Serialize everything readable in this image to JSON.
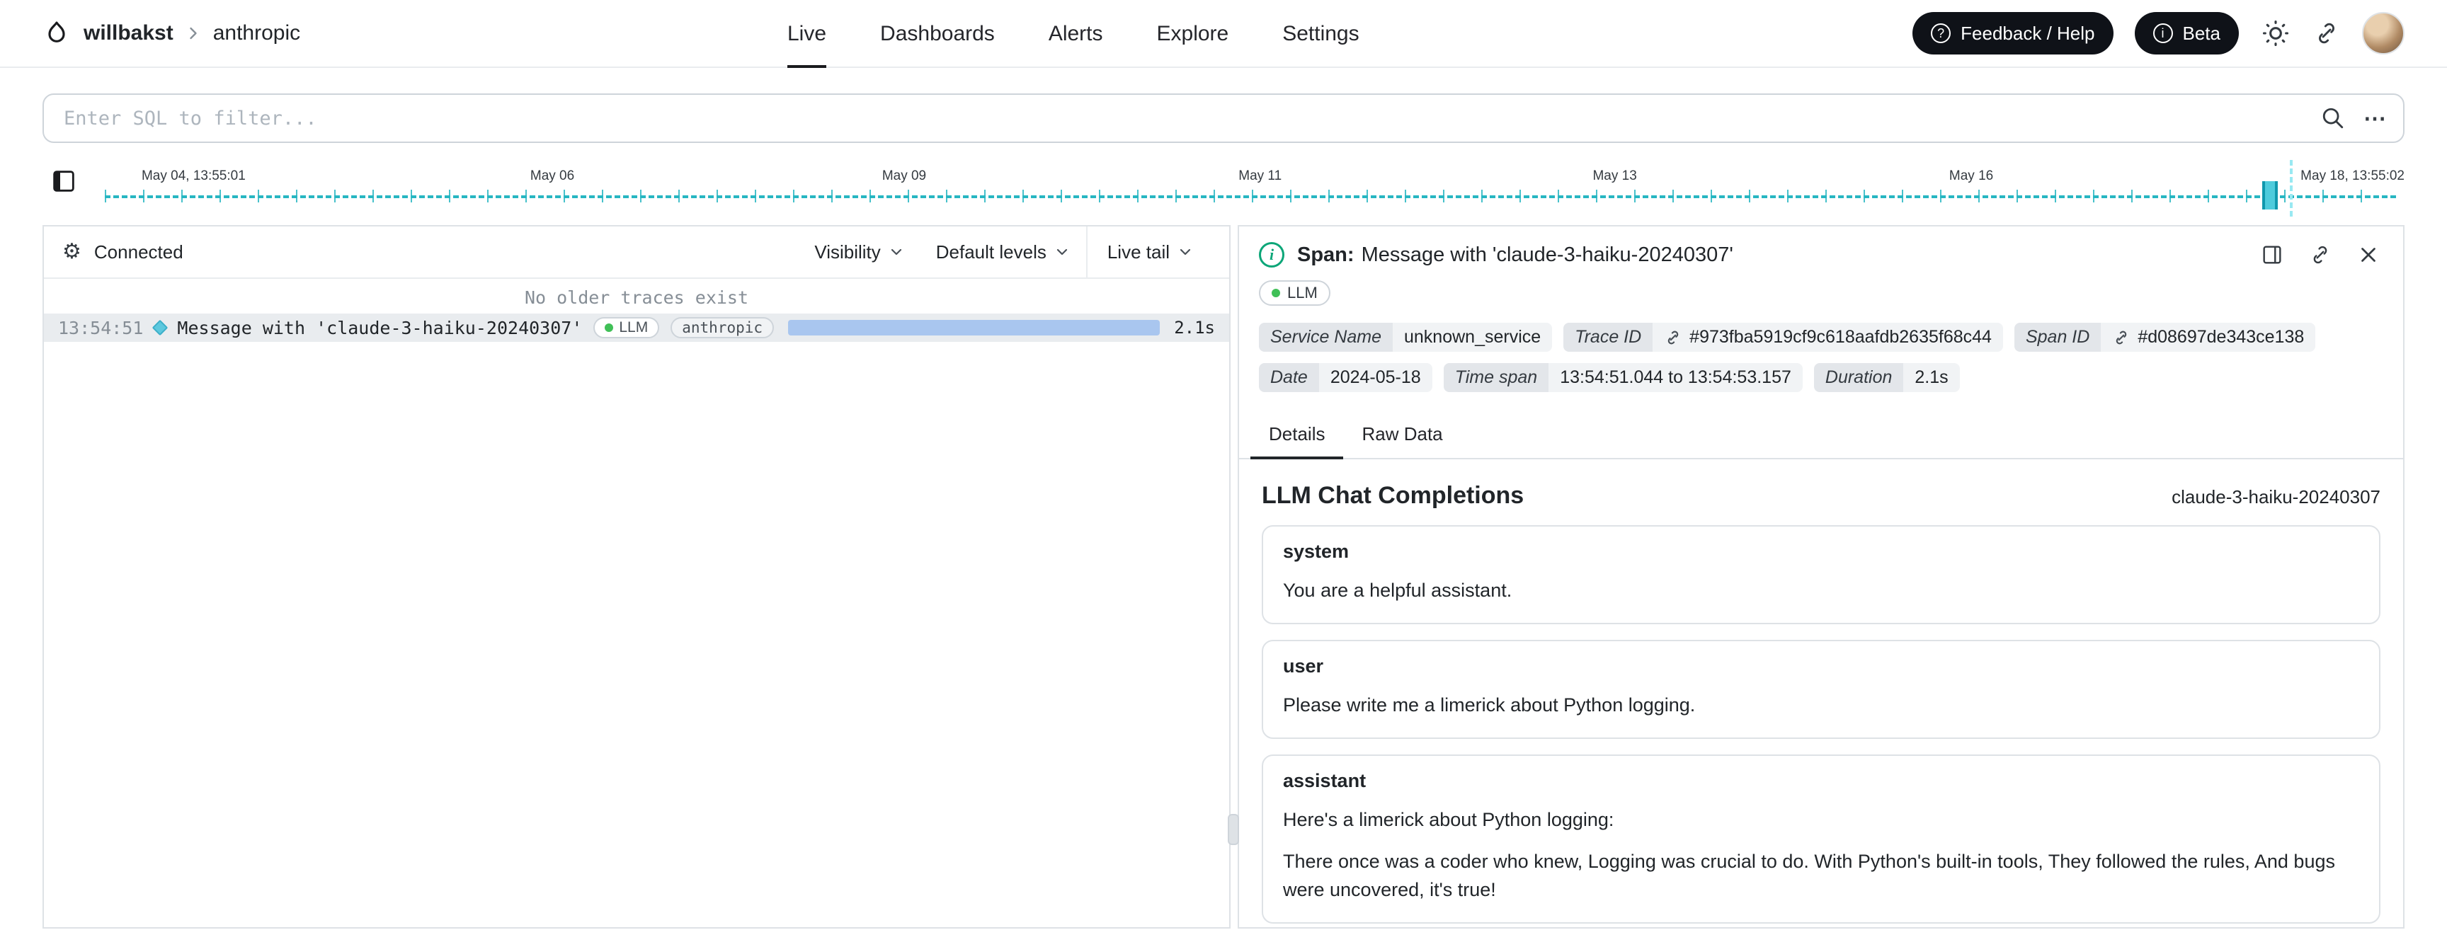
{
  "nav": {
    "org": "willbakst",
    "project": "anthropic",
    "items": [
      {
        "label": "Live",
        "active": true
      },
      {
        "label": "Dashboards",
        "active": false
      },
      {
        "label": "Alerts",
        "active": false
      },
      {
        "label": "Explore",
        "active": false
      },
      {
        "label": "Settings",
        "active": false
      }
    ],
    "feedback_button": "Feedback / Help",
    "beta_button": "Beta"
  },
  "icons": {
    "help": "?",
    "info": "i",
    "gear": "⚙",
    "ellipsis": "⋯"
  },
  "search": {
    "placeholder": "Enter SQL to filter..."
  },
  "timeline": {
    "ticks": [
      "May 04, 13:55:01",
      "May 06",
      "May 09",
      "May 11",
      "May 13",
      "May 16",
      "May 18, 13:55:02"
    ]
  },
  "left_panel": {
    "status": "Connected",
    "visibility": "Visibility",
    "default_levels": "Default levels",
    "live_tail": "Live tail",
    "empty_message": "No older traces exist",
    "trace": {
      "time": "13:54:51",
      "title": "Message with 'claude-3-haiku-20240307'",
      "badge_llm": "LLM",
      "badge_source": "anthropic",
      "duration": "2.1s"
    }
  },
  "span_panel": {
    "title_prefix": "Span:",
    "title": "Message with 'claude-3-haiku-20240307'",
    "type_badge": "LLM",
    "properties": {
      "service_label": "Service Name",
      "service_value": "unknown_service",
      "trace_label": "Trace ID",
      "trace_value": "#973fba5919cf9c618aafdb2635f68c44",
      "span_label": "Span ID",
      "span_value": "#d08697de343ce138",
      "date_label": "Date",
      "date_value": "2024-05-18",
      "timespan_label": "Time span",
      "timespan_value": "13:54:51.044 to 13:54:53.157",
      "duration_label": "Duration",
      "duration_value": "2.1s"
    },
    "tabs": [
      {
        "label": "Details",
        "active": true
      },
      {
        "label": "Raw Data",
        "active": false
      }
    ],
    "section_title": "LLM Chat Completions",
    "model": "claude-3-haiku-20240307",
    "messages": [
      {
        "role": "system",
        "paragraphs": [
          "You are a helpful assistant."
        ]
      },
      {
        "role": "user",
        "paragraphs": [
          "Please write me a limerick about Python logging."
        ]
      },
      {
        "role": "assistant",
        "paragraphs": [
          "Here's a limerick about Python logging:",
          "There once was a coder who knew, Logging was crucial to do. With Python's built-in tools, They followed the rules, And bugs were uncovered, it's true!"
        ]
      }
    ]
  },
  "colors": {
    "accent_teal": "#27b6c2",
    "status_green": "#40c057",
    "trace_bar_blue": "#a9c6ef",
    "dark_button": "#0f1218"
  }
}
